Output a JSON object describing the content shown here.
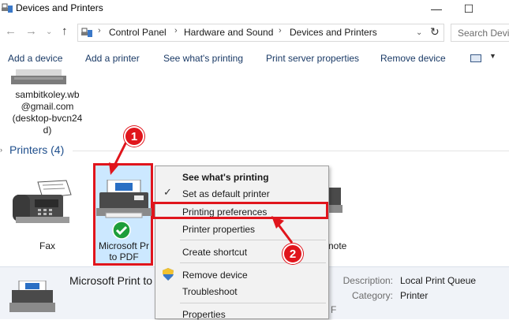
{
  "window": {
    "title": "Devices and Printers"
  },
  "address": {
    "crumbs": [
      "Control Panel",
      "Hardware and Sound",
      "Devices and Printers"
    ],
    "search_placeholder": "Search Devi..."
  },
  "commands": {
    "add_device": "Add a device",
    "add_printer": "Add a printer",
    "see_printing": "See what's printing",
    "server_props": "Print server properties",
    "remove_device": "Remove device"
  },
  "devices": {
    "user_device_lines": [
      "sambitkoley.wb",
      "@gmail.com",
      "(desktop-bvcn24",
      "d)"
    ]
  },
  "printers": {
    "header": "Printers (4)",
    "fax_label": "Fax",
    "pdf_label_line1": "Microsoft Pr",
    "pdf_label_line2": "to PDF",
    "onenote_label": "note"
  },
  "context_menu": {
    "items": [
      "See what's printing",
      "Set as default printer",
      "Printing preferences",
      "Printer properties",
      "Create shortcut",
      "Remove device",
      "Troubleshoot",
      "Properties"
    ]
  },
  "details": {
    "name": "Microsoft Print to I",
    "description_label": "Description:",
    "description_value": "Local Print Queue",
    "category_label": "Category:",
    "category_value": "Printer",
    "fragment": "F"
  },
  "callouts": {
    "one": "1",
    "two": "2"
  },
  "colors": {
    "accent_red": "#e0151c",
    "selection": "#cce8ff",
    "header_blue": "#1e4e8c"
  }
}
